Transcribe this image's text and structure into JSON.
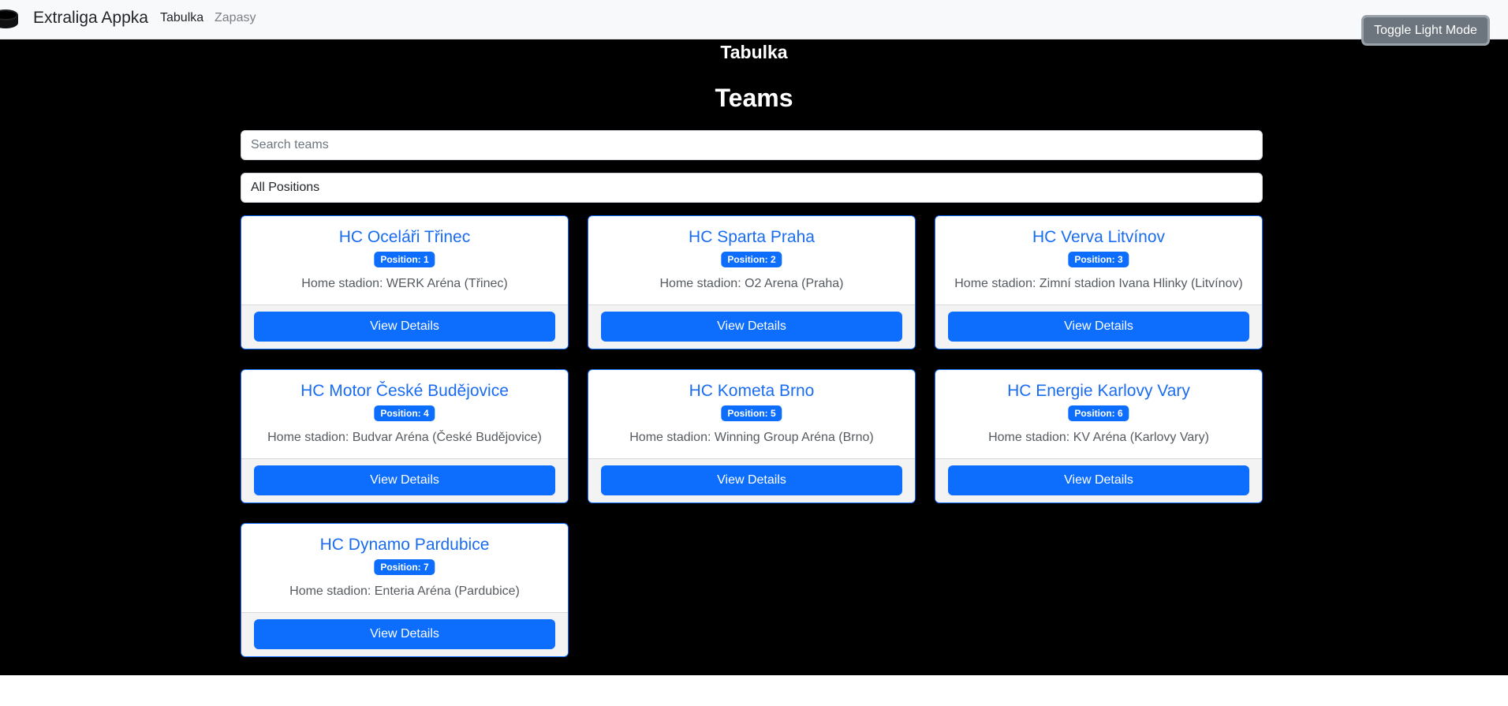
{
  "navbar": {
    "brand": "Extraliga Appka",
    "links": [
      "Tabulka",
      "Zapasy"
    ],
    "toggle_label": "Toggle Light Mode"
  },
  "page": {
    "subtitle": "Tabulka",
    "title": "Teams"
  },
  "search": {
    "placeholder": "Search teams",
    "value": ""
  },
  "position_filter": {
    "selected": "All Positions"
  },
  "teams": [
    {
      "name": "HC Oceláři Třinec",
      "position": "Position: 1",
      "stadium": "Home stadion: WERK Aréna (Třinec)",
      "button": "View Details"
    },
    {
      "name": "HC Sparta Praha",
      "position": "Position: 2",
      "stadium": "Home stadion: O2 Arena (Praha)",
      "button": "View Details"
    },
    {
      "name": "HC Verva Litvínov",
      "position": "Position: 3",
      "stadium": "Home stadion: Zimní stadion Ivana Hlinky (Litvínov)",
      "button": "View Details"
    },
    {
      "name": "HC Motor České Budějovice",
      "position": "Position: 4",
      "stadium": "Home stadion: Budvar Aréna (České Budějovice)",
      "button": "View Details"
    },
    {
      "name": "HC Kometa Brno",
      "position": "Position: 5",
      "stadium": "Home stadion: Winning Group Aréna (Brno)",
      "button": "View Details"
    },
    {
      "name": "HC Energie Karlovy Vary",
      "position": "Position: 6",
      "stadium": "Home stadion: KV Aréna (Karlovy Vary)",
      "button": "View Details"
    },
    {
      "name": "HC Dynamo Pardubice",
      "position": "Position: 7",
      "stadium": "Home stadion: Enteria Aréna (Pardubice)",
      "button": "View Details"
    }
  ]
}
